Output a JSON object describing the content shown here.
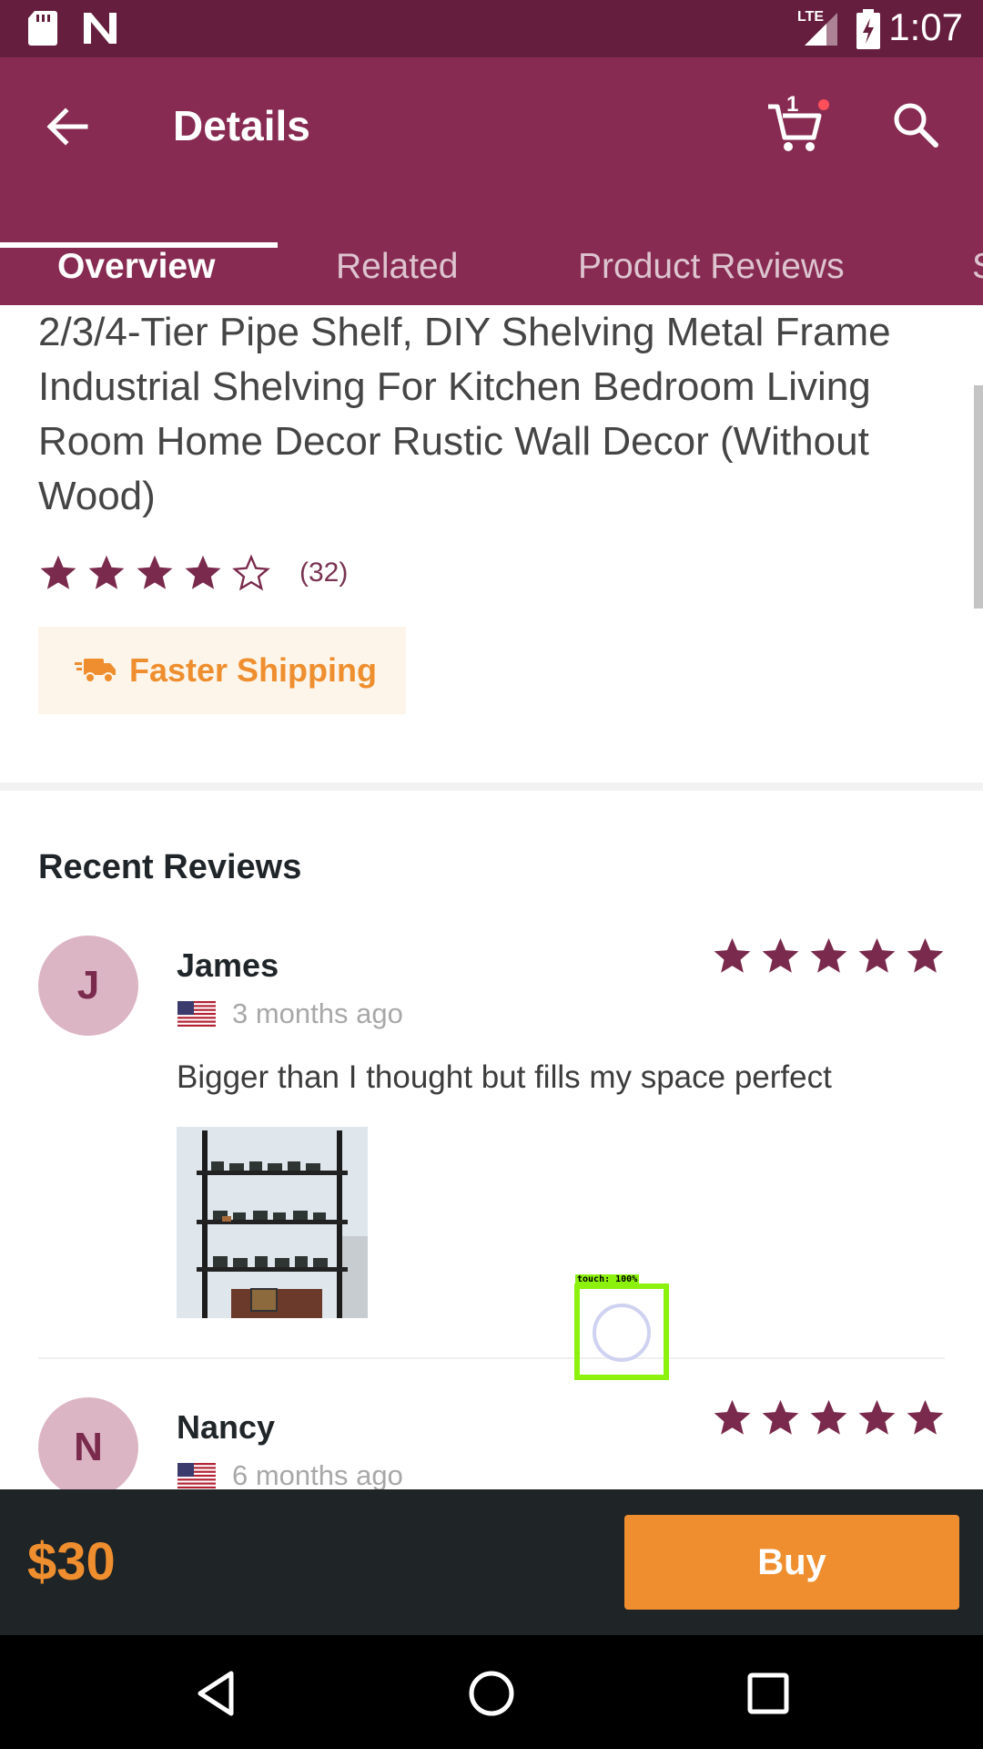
{
  "status_bar": {
    "time": "1:07",
    "icons": [
      "sd-card-icon",
      "n-notification-icon",
      "lte-signal-icon",
      "battery-charging-icon"
    ],
    "lte_label": "LTE"
  },
  "app_bar": {
    "title": "Details",
    "cart_count": "1",
    "tabs": [
      {
        "label": "Overview",
        "active": true
      },
      {
        "label": "Related",
        "active": false
      },
      {
        "label": "Product Reviews",
        "active": false
      },
      {
        "label": "S",
        "active": false
      }
    ]
  },
  "product": {
    "title": "2/3/4-Tier Pipe Shelf, DIY Shelving Metal Frame Industrial Shelving For Kitchen Bedroom Living Room Home Decor Rustic Wall Decor (Without Wood)",
    "rating": 4,
    "rating_max": 5,
    "rating_count": "(32)",
    "shipping_badge": "Faster Shipping"
  },
  "reviews_section": {
    "title": "Recent Reviews",
    "reviews": [
      {
        "initial": "J",
        "name": "James",
        "time": "3 months ago",
        "stars": 5,
        "text": "Bigger than I thought but fills my space perfect",
        "has_photo": true
      },
      {
        "initial": "N",
        "name": "Nancy",
        "time": "6 months ago",
        "stars": 5,
        "text": "",
        "has_photo": false
      }
    ]
  },
  "touch_indicator": {
    "label": "touch: 100%"
  },
  "buy_bar": {
    "price": "$30",
    "buy_label": "Buy"
  },
  "colors": {
    "status_bar": "#661e3e",
    "app_bar": "#872b52",
    "star": "#7a2a4c",
    "accent_orange": "#ef8e2e",
    "buy_bar": "#1f2426"
  }
}
